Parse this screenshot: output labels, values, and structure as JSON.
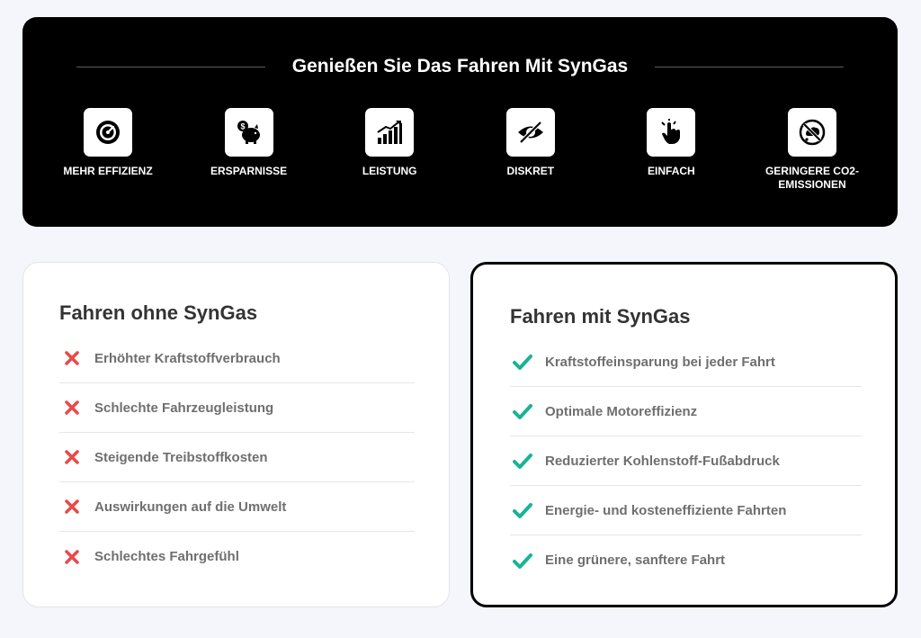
{
  "banner": {
    "title": "Genießen Sie Das Fahren Mit SynGas",
    "features": [
      {
        "label": "MEHR EFFIZIENZ",
        "icon": "speedometer-icon"
      },
      {
        "label": "ERSPARNISSE",
        "icon": "piggy-bank-icon"
      },
      {
        "label": "LEISTUNG",
        "icon": "bar-chart-growth-icon"
      },
      {
        "label": "DISKRET",
        "icon": "eye-off-icon"
      },
      {
        "label": "EINFACH",
        "icon": "tap-hand-icon"
      },
      {
        "label": "GERINGERE CO2-EMISSIONEN",
        "icon": "no-emissions-icon"
      }
    ]
  },
  "without": {
    "title": "Fahren ohne SynGas",
    "icon": "cross-icon",
    "icon_color": "#e84b4b",
    "items": [
      "Erhöhter Kraftstoffverbrauch",
      "Schlechte Fahrzeugleistung",
      "Steigende Treibstoffkosten",
      "Auswirkungen auf die Umwelt",
      "Schlechtes Fahrgefühl"
    ]
  },
  "with": {
    "title": "Fahren mit SynGas",
    "icon": "check-icon",
    "icon_color": "#1ab394",
    "items": [
      "Kraftstoffeinsparung bei jeder Fahrt",
      "Optimale Motoreffizienz",
      "Reduzierter Kohlenstoff-Fußabdruck",
      "Energie- und kosteneffiziente Fahrten",
      "Eine grünere, sanftere Fahrt"
    ]
  }
}
